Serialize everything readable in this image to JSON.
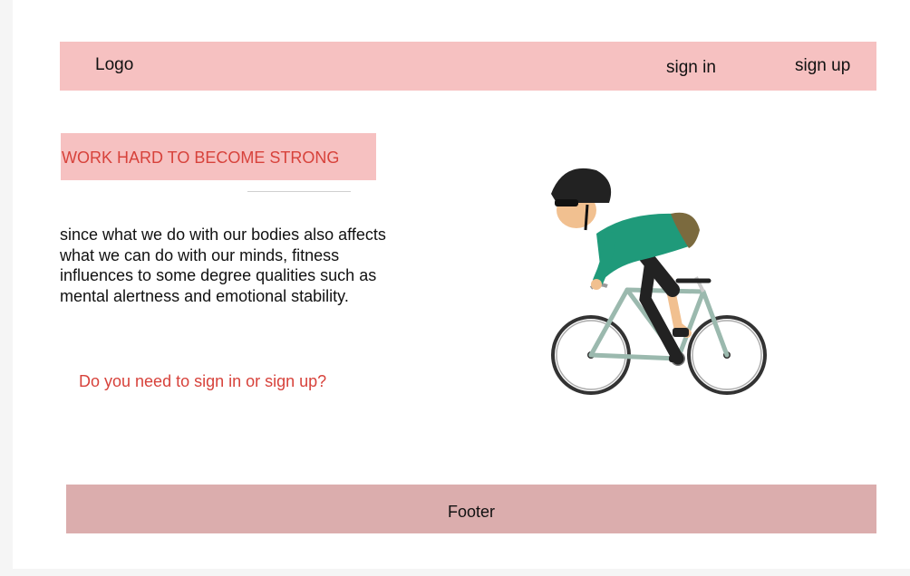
{
  "header": {
    "logo": "Logo",
    "sign_in": "sign in",
    "sign_up": "sign up"
  },
  "hero": {
    "title": "WORK HARD TO BECOME STRONG",
    "body": "since what we do with our bodies also affects what we can do with our minds, fitness influences to some degree qualities such as mental alertness and emotional stability.",
    "cta": "Do you need to sign in or sign up?"
  },
  "footer": {
    "label": "Footer"
  },
  "colors": {
    "header_bg": "#f6c1c1",
    "accent_text": "#d7423b",
    "footer_bg": "#dbadad"
  }
}
